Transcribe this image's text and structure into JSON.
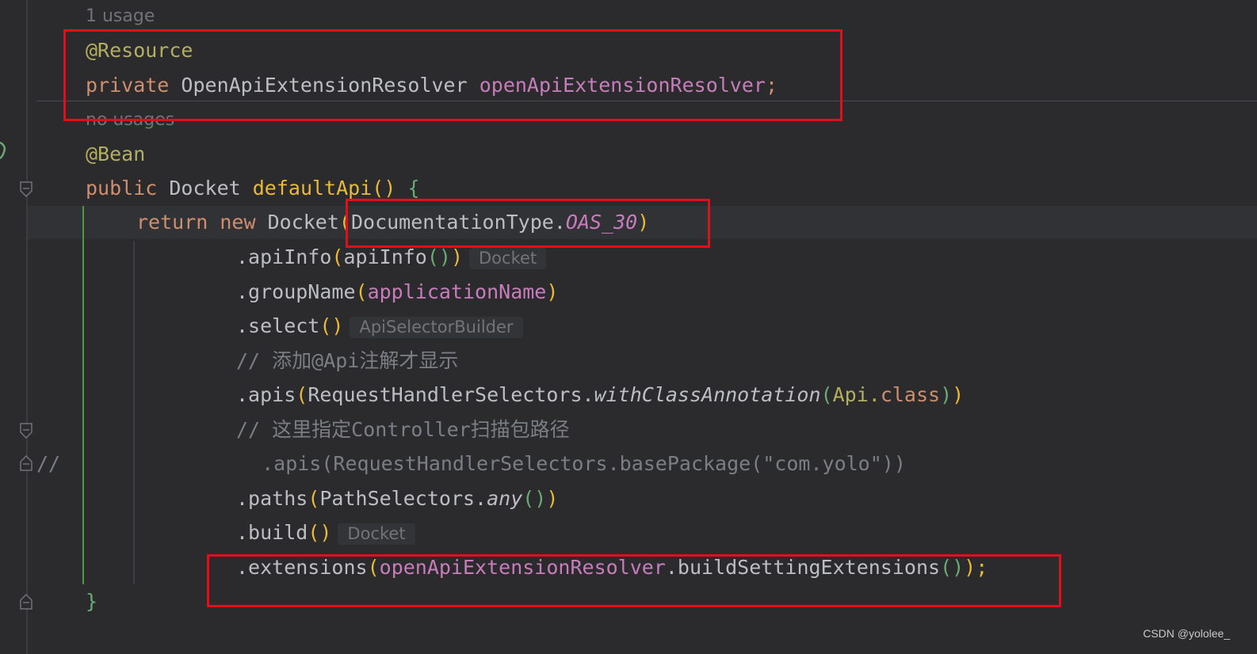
{
  "editor": {
    "hint_1": "1 usage",
    "hint_2": "no usages",
    "line_annotation_resource": "@Resource",
    "line_private": "private",
    "type_resolver": "OpenApiExtensionResolver",
    "field_resolver": "openApiExtensionResolver",
    "semicolon": ";",
    "line_annotation_bean": "@Bean",
    "kw_public": "public",
    "type_docket": "Docket",
    "method_default_api": "defaultApi",
    "paren_empty": "()",
    "brace_open": "{",
    "kw_return": "return",
    "kw_new": "new",
    "type_docket_ctor": "Docket",
    "paren_open": "(",
    "documentation_type": "DocumentationType.",
    "const_oas": "OAS_30",
    "paren_close": ")",
    "call_api_info": ".apiInfo",
    "arg_api_info": "apiInfo",
    "inlay_docket_1": "Docket",
    "call_group_name": ".groupName",
    "arg_application_name": "applicationName",
    "call_select": ".select",
    "inlay_api_selector": "ApiSelectorBuilder",
    "comment_1": "// 添加@Api注解才显示",
    "call_apis": ".apis",
    "request_handler_selectors": "RequestHandlerSelectors.",
    "with_class_annotation": "withClassAnnotation",
    "arg_api": "Api.",
    "kw_class": "class",
    "comment_2": "// 这里指定Controller扫描包路径",
    "commented_prefix": "//",
    "commented_code": "  .apis(RequestHandlerSelectors.basePackage(\"com.yolo\"))",
    "call_paths": ".paths",
    "path_selectors": "PathSelectors.",
    "method_any": "any",
    "call_build": ".build",
    "inlay_docket_2": "Docket",
    "call_extensions": ".extensions",
    "arg_resolver": "openApiExtensionResolver",
    "build_setting_extensions": ".buildSettingExtensions",
    "close_semicolon": ");",
    "brace_close": "}"
  },
  "watermark": "CSDN @yololee_",
  "colors": {
    "background": "#2b2b2d",
    "keyword": "#cf8e6d",
    "annotation": "#b3ae60",
    "field": "#c77dbb",
    "comment": "#7a7e85",
    "highlight_box": "#e0101a",
    "guide_green": "#4e9a43"
  },
  "icons": [
    "fold-marker-icon",
    "bean-gutter-icon"
  ]
}
